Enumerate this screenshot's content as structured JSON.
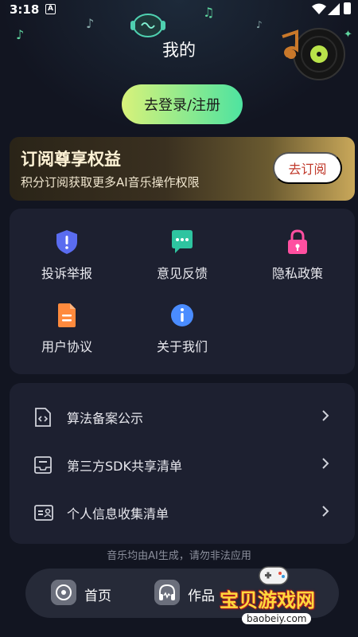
{
  "status_bar": {
    "time": "3:18",
    "notification_badge": "A"
  },
  "header": {
    "title": "我的"
  },
  "login": {
    "label": "去登录/注册"
  },
  "subscription": {
    "title": "订阅尊享权益",
    "description": "积分订阅获取更多AI音乐操作权限",
    "button_label": "去订阅"
  },
  "shortcuts": [
    {
      "label": "投诉举报",
      "icon": "shield-alert-icon",
      "color": "#5a6cf0"
    },
    {
      "label": "意见反馈",
      "icon": "chat-bubble-icon",
      "color": "#2ec4a0"
    },
    {
      "label": "隐私政策",
      "icon": "lock-icon",
      "color": "#ff4fa0"
    },
    {
      "label": "用户协议",
      "icon": "document-icon",
      "color": "#ff8a3d"
    },
    {
      "label": "关于我们",
      "icon": "info-icon",
      "color": "#4a8cff"
    }
  ],
  "list": [
    {
      "label": "算法备案公示",
      "icon": "code-file-icon"
    },
    {
      "label": "第三方SDK共享清单",
      "icon": "tray-icon"
    },
    {
      "label": "个人信息收集清单",
      "icon": "id-card-icon"
    }
  ],
  "disclaimer": "音乐均由AI生成，请勿非法应用",
  "bottom_nav": [
    {
      "label": "首页",
      "icon": "disc-icon"
    },
    {
      "label": "作品",
      "icon": "headphones-icon"
    }
  ],
  "watermark": {
    "text": "宝贝游戏网",
    "domain": "baobeiy.com"
  },
  "colors": {
    "accent_start": "#d8f27a",
    "accent_end": "#4ee3a0",
    "card_bg": "#1d2030",
    "page_bg": "#121521"
  }
}
